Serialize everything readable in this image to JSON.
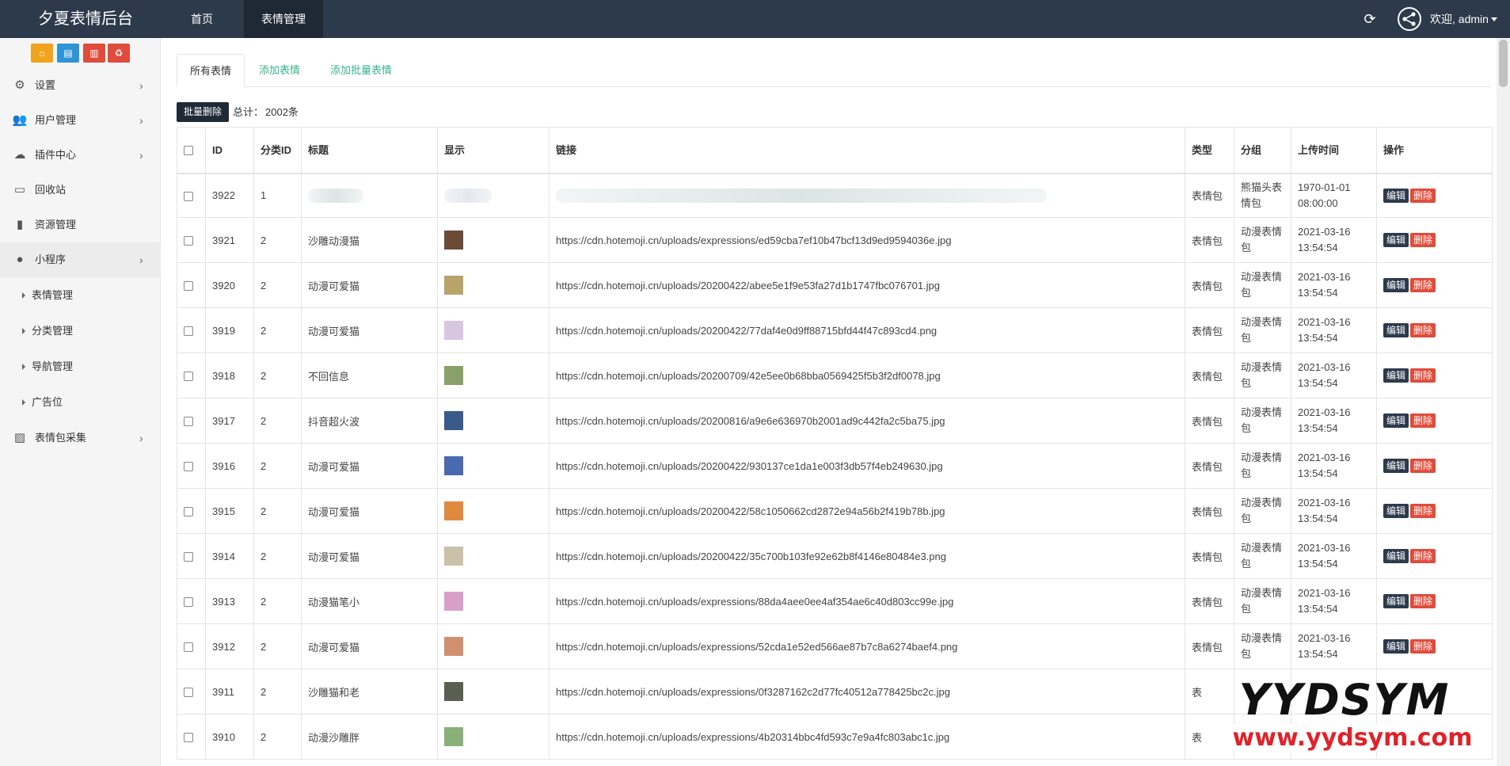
{
  "header": {
    "brand": "夕夏表情后台",
    "nav": [
      {
        "label": "首页",
        "active": false
      },
      {
        "label": "表情管理",
        "active": true
      }
    ],
    "refresh_icon": "refresh-icon",
    "welcome": "欢迎, admin"
  },
  "sidebar": {
    "quick_buttons": [
      {
        "icon": "home-icon",
        "color": "#f0a31c"
      },
      {
        "icon": "file-icon",
        "color": "#2f94d6"
      },
      {
        "icon": "trash-icon",
        "color": "#e14b3b"
      },
      {
        "icon": "recycle-icon",
        "color": "#e14b3b"
      }
    ],
    "items": [
      {
        "label": "设置",
        "icon": "gears-icon"
      },
      {
        "label": "用户管理",
        "icon": "users-icon"
      },
      {
        "label": "插件中心",
        "icon": "cloud-icon"
      },
      {
        "label": "回收站",
        "icon": "monitor-icon"
      },
      {
        "label": "资源管理",
        "icon": "file-icon"
      },
      {
        "label": "小程序",
        "icon": "wechat-icon"
      },
      {
        "label": "表情包采集",
        "icon": "image-icon"
      }
    ],
    "sub_items": [
      {
        "label": "表情管理"
      },
      {
        "label": "分类管理"
      },
      {
        "label": "导航管理"
      },
      {
        "label": "广告位"
      }
    ]
  },
  "tabs": [
    {
      "label": "所有表情",
      "active": true
    },
    {
      "label": "添加表情",
      "active": false
    },
    {
      "label": "添加批量表情",
      "active": false
    }
  ],
  "toolbar": {
    "bulk_delete": "批量删除",
    "total_label": "总计：",
    "total_value": "2002条"
  },
  "table": {
    "columns": [
      "ID",
      "分类ID",
      "标题",
      "显示",
      "链接",
      "类型",
      "分组",
      "上传时间",
      "操作"
    ],
    "edit_label": "编辑",
    "delete_label": "删除",
    "rows": [
      {
        "id": "3922",
        "cat": "1",
        "title": "",
        "link": "/wp-content/uploads/2020/08/1598008674",
        "type": "表情包",
        "group": "熊猫头表情包",
        "time": "1970-01-01 08:00:00",
        "thumb": "#e6e6e6"
      },
      {
        "id": "3921",
        "cat": "2",
        "title": "沙雕动漫猫",
        "link": "https://cdn.hotemoji.cn/uploads/expressions/ed59cba7ef10b47bcf13d9ed9594036e.jpg",
        "type": "表情包",
        "group": "动漫表情包",
        "time": "2021-03-16 13:54:54",
        "thumb": "#6b4a3a"
      },
      {
        "id": "3920",
        "cat": "2",
        "title": "动漫可爱猫",
        "link": "https://cdn.hotemoji.cn/uploads/20200422/abee5e1f9e53fa27d1b1747fbc076701.jpg",
        "type": "表情包",
        "group": "动漫表情包",
        "time": "2021-03-16 13:54:54",
        "thumb": "#b8a36a"
      },
      {
        "id": "3919",
        "cat": "2",
        "title": "动漫可爱猫",
        "link": "https://cdn.hotemoji.cn/uploads/20200422/77daf4e0d9ff88715bfd44f47c893cd4.png",
        "type": "表情包",
        "group": "动漫表情包",
        "time": "2021-03-16 13:54:54",
        "thumb": "#d8c6e0"
      },
      {
        "id": "3918",
        "cat": "2",
        "title": "不回信息",
        "link": "https://cdn.hotemoji.cn/uploads/20200709/42e5ee0b68bba0569425f5b3f2df0078.jpg",
        "type": "表情包",
        "group": "动漫表情包",
        "time": "2021-03-16 13:54:54",
        "thumb": "#8aa06a"
      },
      {
        "id": "3917",
        "cat": "2",
        "title": "抖音超火波",
        "link": "https://cdn.hotemoji.cn/uploads/20200816/a9e6e636970b2001ad9c442fa2c5ba75.jpg",
        "type": "表情包",
        "group": "动漫表情包",
        "time": "2021-03-16 13:54:54",
        "thumb": "#3a5a8a"
      },
      {
        "id": "3916",
        "cat": "2",
        "title": "动漫可爱猫",
        "link": "https://cdn.hotemoji.cn/uploads/20200422/930137ce1da1e003f3db57f4eb249630.jpg",
        "type": "表情包",
        "group": "动漫表情包",
        "time": "2021-03-16 13:54:54",
        "thumb": "#4a6ab0"
      },
      {
        "id": "3915",
        "cat": "2",
        "title": "动漫可爱猫",
        "link": "https://cdn.hotemoji.cn/uploads/20200422/58c1050662cd2872e94a56b2f419b78b.jpg",
        "type": "表情包",
        "group": "动漫表情包",
        "time": "2021-03-16 13:54:54",
        "thumb": "#e08a40"
      },
      {
        "id": "3914",
        "cat": "2",
        "title": "动漫可爱猫",
        "link": "https://cdn.hotemoji.cn/uploads/20200422/35c700b103fe92e62b8f4146e80484e3.png",
        "type": "表情包",
        "group": "动漫表情包",
        "time": "2021-03-16 13:54:54",
        "thumb": "#c9c2a8"
      },
      {
        "id": "3913",
        "cat": "2",
        "title": "动漫猫笔小",
        "link": "https://cdn.hotemoji.cn/uploads/expressions/88da4aee0ee4af354ae6c40d803cc99e.jpg",
        "type": "表情包",
        "group": "动漫表情包",
        "time": "2021-03-16 13:54:54",
        "thumb": "#d8a0c8"
      },
      {
        "id": "3912",
        "cat": "2",
        "title": "动漫可爱猫",
        "link": "https://cdn.hotemoji.cn/uploads/expressions/52cda1e52ed566ae87b7c8a6274baef4.png",
        "type": "表情包",
        "group": "动漫表情包",
        "time": "2021-03-16 13:54:54",
        "thumb": "#d09070"
      },
      {
        "id": "3911",
        "cat": "2",
        "title": "沙雕猫和老",
        "link": "https://cdn.hotemoji.cn/uploads/expressions/0f3287162c2d77fc40512a778425bc2c.jpg",
        "type": "表",
        "group": "",
        "time": "",
        "thumb": "#5a6050"
      },
      {
        "id": "3910",
        "cat": "2",
        "title": "动漫沙雕胖",
        "link": "https://cdn.hotemoji.cn/uploads/expressions/4b20314bbc4fd593c7e9a4fc803abc1c.jpg",
        "type": "表",
        "group": "",
        "time": "",
        "thumb": "#8ab07a"
      }
    ]
  },
  "watermark": {
    "top": "YYDSYM",
    "bottom": "www.yydsym.com"
  },
  "colors": {
    "header_bg": "#2d3a4b",
    "link": "#3bb18e",
    "danger": "#e14b3b",
    "warning": "#f0a31c",
    "info": "#2f94d6"
  }
}
